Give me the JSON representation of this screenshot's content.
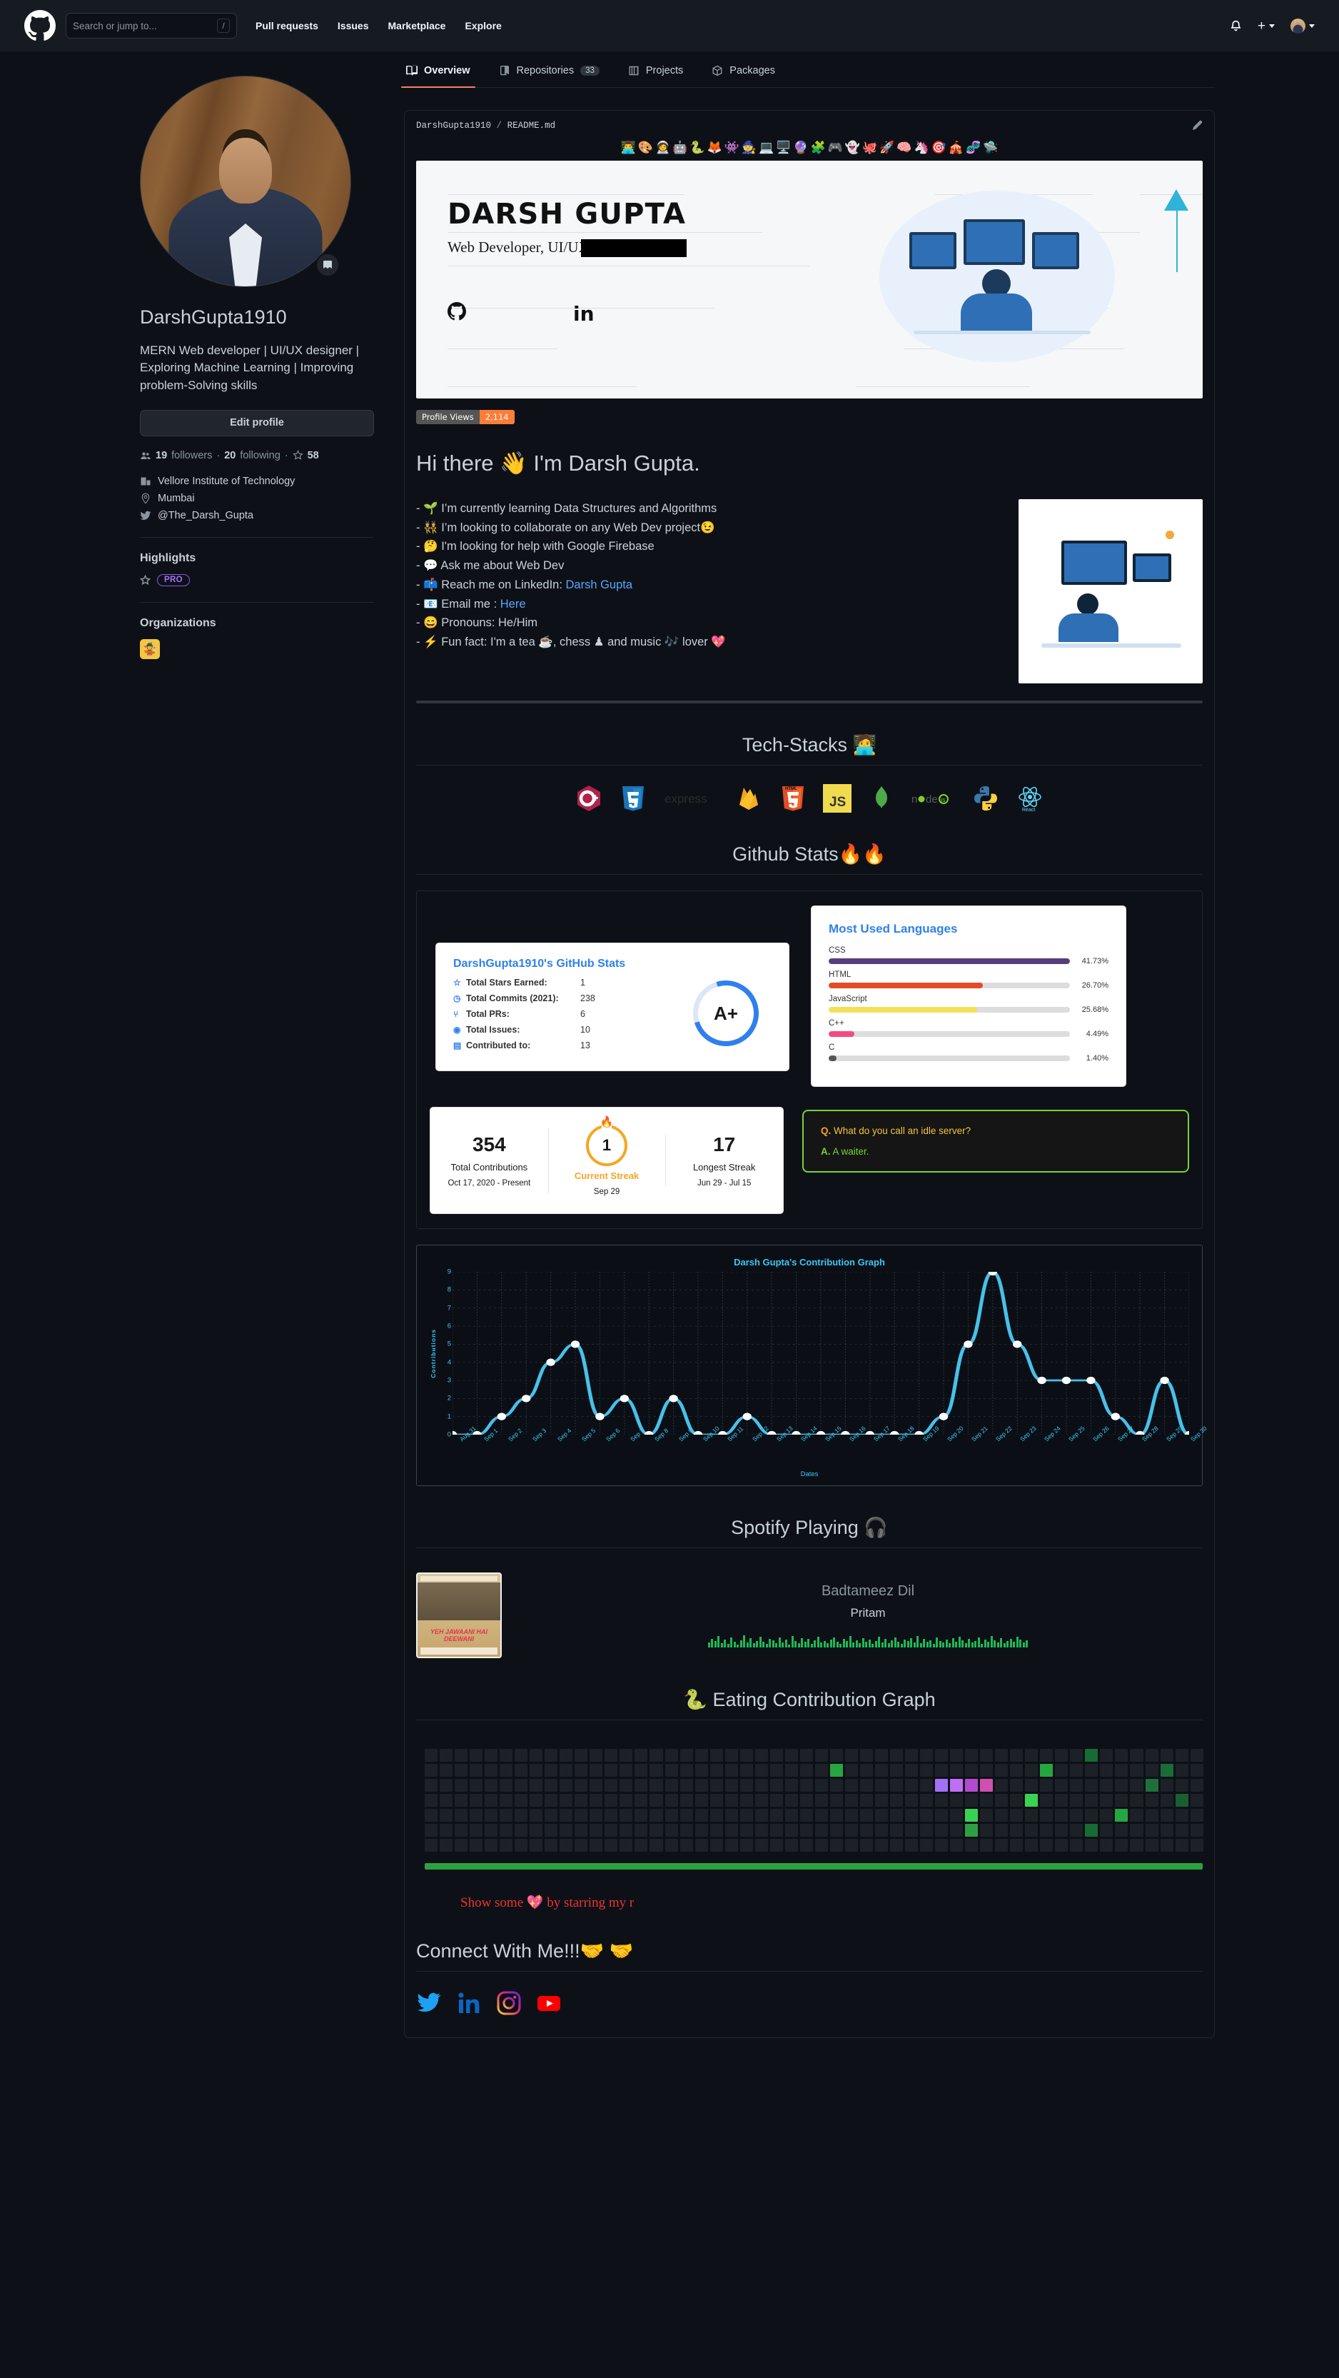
{
  "header": {
    "logo_icon": "github-mark-icon",
    "search_placeholder": "Search or jump to...",
    "search_value": "",
    "slash_hint": "/",
    "nav": [
      "Pull requests",
      "Issues",
      "Marketplace",
      "Explore"
    ],
    "notifications_icon": "bell-icon",
    "create_new_icon": "plus-icon",
    "account_icon": "avatar"
  },
  "sidebar": {
    "username": "DarshGupta1910",
    "bio": "MERN Web developer | UI/UX designer | Exploring Machine Learning | Improving problem-Solving skills",
    "edit_profile_label": "Edit profile",
    "followers_count": "19",
    "followers_label": "followers",
    "following_count": "20",
    "following_label": "following",
    "stars_count": "58",
    "company": "Vellore Institute of Technology",
    "location": "Mumbai",
    "twitter": "@The_Darsh_Gupta",
    "highlights_heading": "Highlights",
    "pro_badge": "PRO",
    "organizations_heading": "Organizations",
    "org_emoji": "🤹"
  },
  "tabs": [
    {
      "label": "Overview",
      "icon": "book-icon",
      "count": null,
      "active": true
    },
    {
      "label": "Repositories",
      "icon": "repo-icon",
      "count": "33",
      "active": false
    },
    {
      "label": "Projects",
      "icon": "project-icon",
      "count": null,
      "active": false
    },
    {
      "label": "Packages",
      "icon": "package-icon",
      "count": null,
      "active": false
    }
  ],
  "readme": {
    "owner": "DarshGupta1910",
    "separator": "/",
    "file": "README.md",
    "edit_icon": "pencil-icon",
    "emoji_strip": [
      "👨‍💻",
      "🎨",
      "🧑‍🚀",
      "🤖",
      "🐍",
      "🦊",
      "👾",
      "🧙",
      "💻",
      "🖥️",
      "🔮",
      "🧩",
      "🎮",
      "👻",
      "🐙",
      "🚀",
      "🧠",
      "🦄",
      "🎯",
      "🎪",
      "🧬",
      "🛸"
    ],
    "banner": {
      "name": "DARSH GUPTA",
      "subtitle": "Web Developer, UI/UX, C",
      "redacted": true,
      "social_icons": [
        "github-icon",
        "linkedin-icon"
      ]
    },
    "profile_views": {
      "label": "Profile Views",
      "value": "2,114",
      "label_color": "#555555",
      "value_color": "#fe7d37"
    },
    "greeting": "Hi there 👋 I'm Darsh Gupta.",
    "bullets": [
      {
        "emoji": "🌱",
        "text": "I’m currently learning Data Structures and Algorithms",
        "link": null,
        "tail": ""
      },
      {
        "emoji": "👯",
        "text": "I’m looking to collaborate on any Web Dev project😉",
        "link": null,
        "tail": ""
      },
      {
        "emoji": "🤔",
        "text": "I'm looking for help with Google Firebase",
        "link": null,
        "tail": ""
      },
      {
        "emoji": "💬",
        "text": "Ask me about Web Dev",
        "link": null,
        "tail": ""
      },
      {
        "emoji": "📫",
        "text": "Reach me on LinkedIn: ",
        "link": "Darsh Gupta",
        "tail": ""
      },
      {
        "emoji": "📧",
        "text": "Email me : ",
        "link": "Here",
        "tail": ""
      },
      {
        "emoji": "😄",
        "text": "Pronouns: He/Him",
        "link": null,
        "tail": ""
      },
      {
        "emoji": "⚡",
        "text": "Fun fact: I'm a tea ☕, chess ♟ and music 🎶 lover 💖",
        "link": null,
        "tail": ""
      }
    ],
    "tech_stacks_heading": "Tech-Stacks 🧑‍💻",
    "tech_stacks": [
      "C++",
      "CSS3",
      "express",
      "Firebase",
      "HTML5",
      "JavaScript",
      "MongoDB",
      "Node.js",
      "Python",
      "React"
    ],
    "github_stats_heading": "Github Stats🔥🔥",
    "github_stats_card": {
      "title": "DarshGupta1910's GitHub Stats",
      "rows": [
        {
          "icon": "star-icon",
          "label": "Total Stars Earned:",
          "value": "1"
        },
        {
          "icon": "clock-icon",
          "label": "Total Commits (2021):",
          "value": "238"
        },
        {
          "icon": "pr-icon",
          "label": "Total PRs:",
          "value": "6"
        },
        {
          "icon": "issue-icon",
          "label": "Total Issues:",
          "value": "10"
        },
        {
          "icon": "repo-icon",
          "label": "Contributed to:",
          "value": "13"
        }
      ],
      "rank": "A+",
      "accent": "#2f80ed"
    },
    "streak_card": {
      "total_contributions": "354",
      "total_contributions_label": "Total Contributions",
      "total_contributions_range": "Oct 17, 2020 - Present",
      "current_streak": "1",
      "current_streak_label": "Current Streak",
      "current_streak_date": "Sep 29",
      "longest_streak": "17",
      "longest_streak_label": "Longest Streak",
      "longest_streak_range": "Jun 29 - Jul 15",
      "accent": "#f5a623"
    },
    "joke_card": {
      "q_prefix": "Q.",
      "question": " What do you call an idle server?",
      "a_prefix": "A.",
      "answer": " A waiter.",
      "border_color": "#7ad236",
      "q_color": "#f2c53d",
      "a_color": "#7ad236"
    },
    "spotify_heading": "Spotify Playing 🎧",
    "spotify": {
      "song": "Badtameez Dil",
      "artist": "Pritam",
      "album_text": "YEH JAWAANI HAI DEEWANI",
      "bar_color": "#1db954"
    },
    "eating_heading": "🐍 Eating Contribution Graph",
    "star_line": "Show some 💖 by starring my r",
    "connect_heading": "Connect With Me!!!🤝 🤝",
    "connect_icons": [
      "twitter-icon",
      "linkedin-icon",
      "instagram-icon",
      "youtube-icon"
    ]
  },
  "chart_data": [
    {
      "type": "bar",
      "title": "Most Used Languages",
      "categories": [
        "CSS",
        "HTML",
        "JavaScript",
        "C++",
        "C"
      ],
      "values": [
        41.73,
        26.7,
        25.68,
        4.49,
        1.4
      ],
      "labels": [
        "41.73%",
        "26.70%",
        "25.68%",
        "4.49%",
        "1.40%"
      ],
      "colors": [
        "#563d7c",
        "#e34c26",
        "#f1e05a",
        "#f34b7d",
        "#555555"
      ],
      "xlabel": "",
      "ylabel": "",
      "ylim": [
        0,
        100
      ],
      "grid": false,
      "legend": "none"
    },
    {
      "type": "line",
      "title": "Darsh Gupta's Contribution Graph",
      "x": [
        "Aug 31",
        "Sep 1",
        "Sep 2",
        "Sep 3",
        "Sep 4",
        "Sep 5",
        "Sep 6",
        "Sep 7",
        "Sep 8",
        "Sep 9",
        "Sep 10",
        "Sep 11",
        "Sep 12",
        "Sep 13",
        "Sep 14",
        "Sep 15",
        "Sep 16",
        "Sep 17",
        "Sep 18",
        "Sep 19",
        "Sep 20",
        "Sep 21",
        "Sep 22",
        "Sep 23",
        "Sep 24",
        "Sep 25",
        "Sep 26",
        "Sep 27",
        "Sep 28",
        "Sep 29",
        "Sep 30"
      ],
      "values": [
        0,
        0,
        1,
        2,
        4,
        5,
        1,
        2,
        0,
        2,
        0,
        0,
        1,
        0,
        0,
        0,
        0,
        0,
        0,
        0,
        1,
        5,
        9,
        5,
        3,
        3,
        3,
        1,
        0,
        3,
        0
      ],
      "xlabel": "Dates",
      "ylabel": "Contributions",
      "ylim": [
        0,
        9
      ],
      "yticks": [
        0,
        1,
        2,
        3,
        4,
        5,
        6,
        7,
        8,
        9
      ],
      "grid": true,
      "legend": "none",
      "line_color": "#47c1ea",
      "point_color": "#ffffff",
      "title_color": "#3bc7f5"
    }
  ]
}
